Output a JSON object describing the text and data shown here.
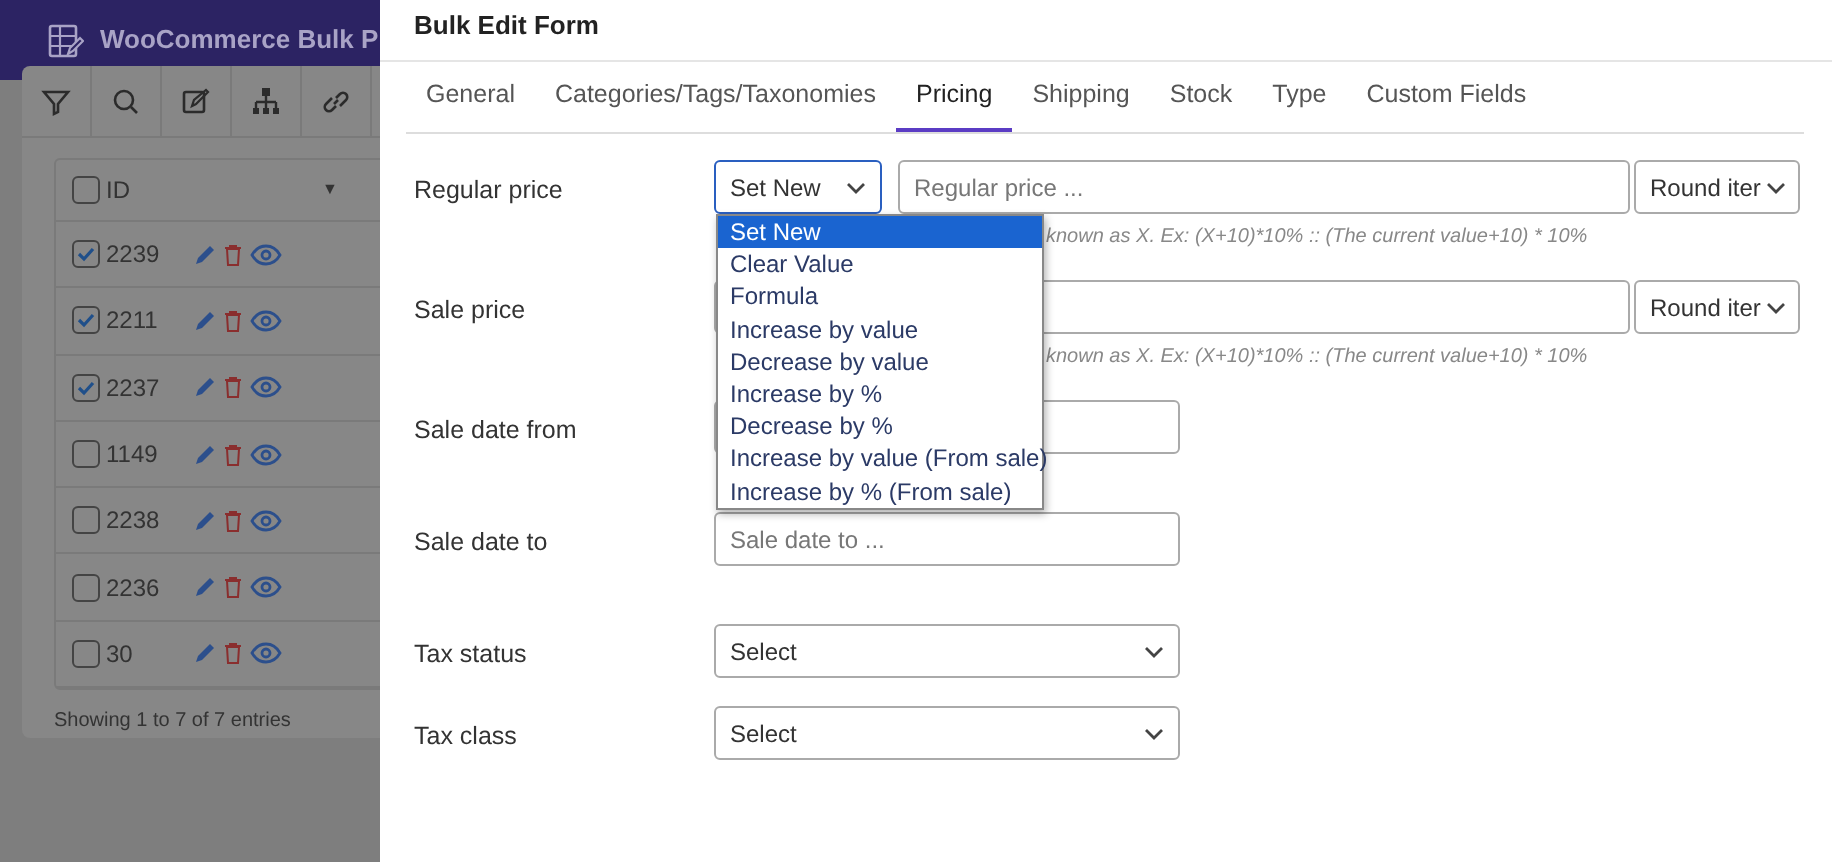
{
  "app": {
    "title": "WooCommerce Bulk P"
  },
  "table": {
    "header": {
      "label": "ID",
      "checked": false,
      "sort": "▼"
    },
    "rows": [
      {
        "id": "2239",
        "checked": true
      },
      {
        "id": "2211",
        "checked": true
      },
      {
        "id": "2237",
        "checked": true
      },
      {
        "id": "1149",
        "checked": false
      },
      {
        "id": "2238",
        "checked": false
      },
      {
        "id": "2236",
        "checked": false
      },
      {
        "id": "30",
        "checked": false
      }
    ],
    "footer": "Showing 1 to 7 of 7 entries"
  },
  "dialog": {
    "title": "Bulk Edit Form",
    "tabs": [
      {
        "label": "General",
        "selected": false
      },
      {
        "label": "Categories/Tags/Taxonomies",
        "selected": false
      },
      {
        "label": "Pricing",
        "selected": true
      },
      {
        "label": "Shipping",
        "selected": false
      },
      {
        "label": "Stock",
        "selected": false
      },
      {
        "label": "Type",
        "selected": false
      },
      {
        "label": "Custom Fields",
        "selected": false
      }
    ],
    "fields": [
      {
        "kind": "price",
        "label": "Regular price",
        "method": "Set New",
        "placeholder": "Regular price ...",
        "rounding": "Round iter",
        "hint": "known as X. Ex: (X+10)*10% :: (The current value+10) * 10%"
      },
      {
        "kind": "price",
        "label": "Sale price",
        "rounding": "Round iter",
        "hint": "known as X. Ex: (X+10)*10% :: (The current value+10) * 10%"
      },
      {
        "kind": "date",
        "label": "Sale date from"
      },
      {
        "kind": "date",
        "label": "Sale date to",
        "placeholder": "Sale date to ..."
      },
      {
        "kind": "select",
        "label": "Tax status",
        "value": "Select"
      },
      {
        "kind": "select",
        "label": "Tax class",
        "value": "Select"
      }
    ],
    "dropdown": [
      {
        "label": "Set New",
        "selected": true
      },
      {
        "label": "Clear Value",
        "selected": false
      },
      {
        "label": "Formula",
        "selected": false
      },
      {
        "label": "Increase by value",
        "selected": false
      },
      {
        "label": "Decrease by value",
        "selected": false
      },
      {
        "label": "Increase by %",
        "selected": false
      },
      {
        "label": "Decrease by %",
        "selected": false
      },
      {
        "label": "Increase by value (From sale)",
        "selected": false
      },
      {
        "label": "Increase by % (From sale)",
        "selected": false
      }
    ]
  }
}
